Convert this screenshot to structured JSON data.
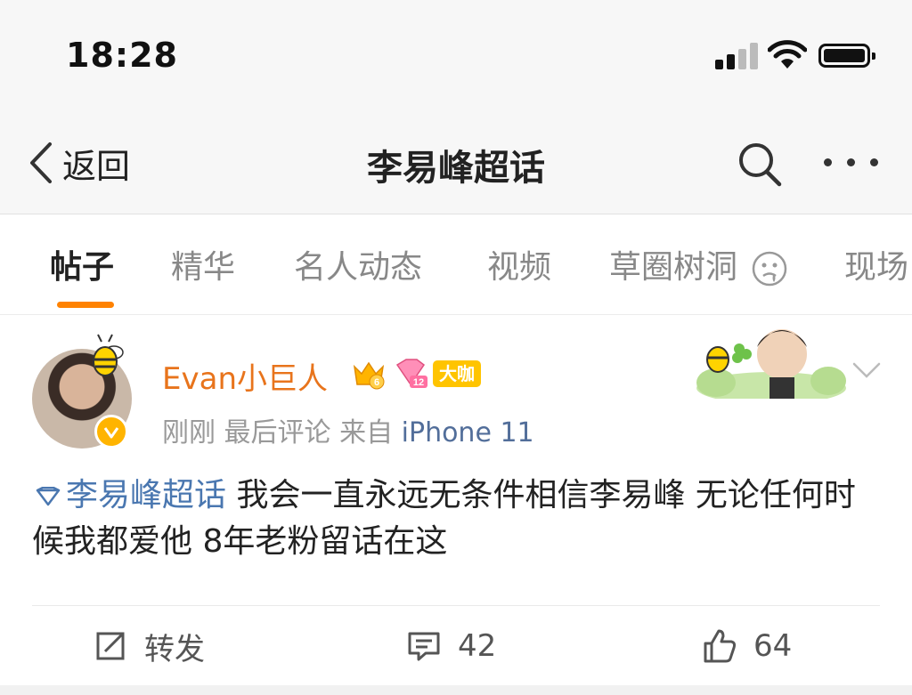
{
  "status_bar": {
    "time": "18:28"
  },
  "nav": {
    "back_label": "返回",
    "title": "李易峰超话"
  },
  "tabs": [
    {
      "label": "帖子"
    },
    {
      "label": "精华"
    },
    {
      "label": "名人动态"
    },
    {
      "label": "视频"
    },
    {
      "label": "草圈树洞"
    },
    {
      "label": "现场"
    }
  ],
  "post": {
    "username": "Evan小巨人",
    "badges": {
      "crown_level": "6",
      "gem_level": "12",
      "tag": "大咖"
    },
    "meta": {
      "time": "刚刚",
      "activity": "最后评论",
      "source_prefix": "来自",
      "source": "iPhone 11"
    },
    "topic": "李易峰超话",
    "text": " 我会一直永远无条件相信李易峰 无论任何时候我都爱他 8年老粉留话在这",
    "actions": {
      "repost_label": "转发",
      "comment_count": "42",
      "like_count": "64"
    }
  },
  "colors": {
    "accent": "#ff8200",
    "username": "#e8741c",
    "link": "#4a77b0",
    "badge": "#ffc400"
  }
}
